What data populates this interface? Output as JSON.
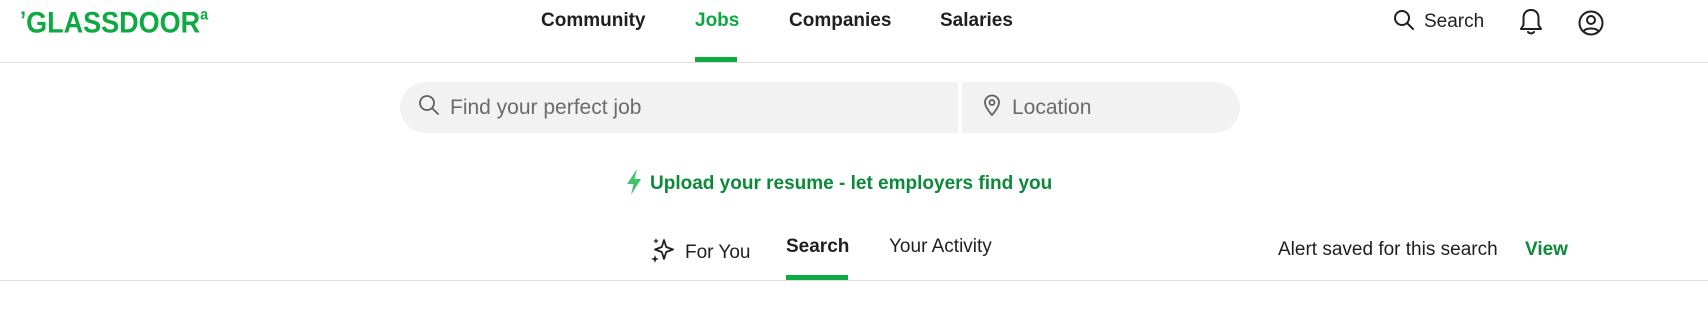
{
  "header": {
    "logo_text": "GLASSDOOR",
    "brand_color": "#0caa41",
    "nav": [
      {
        "label": "Community",
        "active": false
      },
      {
        "label": "Jobs",
        "active": true
      },
      {
        "label": "Companies",
        "active": false
      },
      {
        "label": "Salaries",
        "active": false
      }
    ],
    "search_label": "Search",
    "icons": [
      "search-icon",
      "bell-icon",
      "user-icon"
    ]
  },
  "search": {
    "job_placeholder": "Find your perfect job",
    "job_value": "",
    "location_placeholder": "Location",
    "location_value": ""
  },
  "upload": {
    "text": "Upload your resume - let employers find you",
    "icon": "lightning-icon",
    "color": "#0c8a3a"
  },
  "tabs": [
    {
      "label": "For You",
      "icon": "sparkle-icon",
      "active": false
    },
    {
      "label": "Search",
      "active": true
    },
    {
      "label": "Your Activity",
      "active": false
    }
  ],
  "alert": {
    "text": "Alert saved for this search",
    "view_label": "View"
  }
}
